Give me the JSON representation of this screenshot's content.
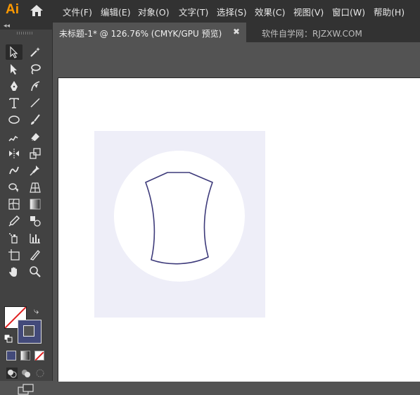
{
  "app": {
    "logo": "Ai"
  },
  "menu": {
    "items": [
      "文件(F)",
      "编辑(E)",
      "对象(O)",
      "文字(T)",
      "选择(S)",
      "效果(C)",
      "视图(V)",
      "窗口(W)",
      "帮助(H)"
    ]
  },
  "tabs": {
    "active_label": "未标题-1* @ 126.76% (CMYK/GPU 预览)",
    "close_label": "✖",
    "second_label": "软件自学网：RJZXW.COM"
  },
  "panel": {
    "collapse_label": "◂◂"
  },
  "colors": {
    "accent": "#ff9a00",
    "stroke": "#3d3a7a",
    "fill_bg": "#eeeef8",
    "circle": "#ffffff"
  }
}
